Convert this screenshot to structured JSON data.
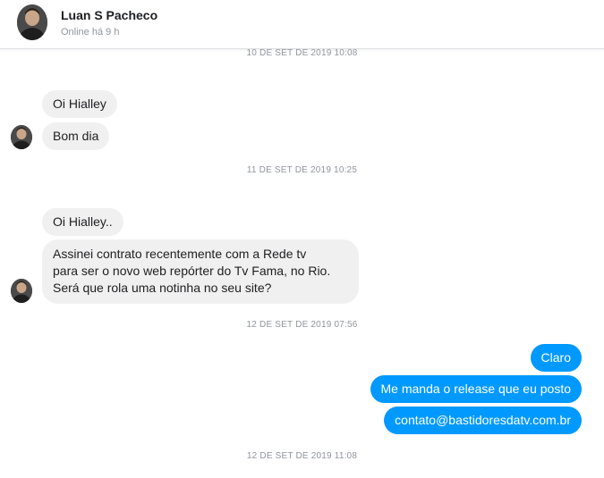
{
  "header": {
    "contact_name": "Luan S Pacheco",
    "contact_status": "Online há 9 h"
  },
  "conversation": {
    "timestamps": [
      "10 DE SET DE 2019 10:08",
      "11 DE SET DE 2019 10:25",
      "12 DE SET DE 2019 07:56",
      "12 DE SET DE 2019 11:08"
    ],
    "group1": [
      "Oi Hialley",
      "Bom dia"
    ],
    "group2": {
      "first": "Oi Hialley..",
      "second_lines": [
        "Assinei contrato recentemente com a Rede tv",
        "para ser o novo web repórter do Tv Fama, no Rio.",
        "Será que rola uma notinha no seu site?"
      ]
    },
    "outgoing": [
      "Claro",
      "Me manda o release que eu posto",
      "contato@bastidoresdatv.com.br"
    ]
  },
  "colors": {
    "incoming_bubble": "#f1f0f0",
    "outgoing_bubble": "#0099ff",
    "timestamp_text": "#90949c"
  },
  "icons": {
    "contact_avatar": "contact-avatar-photo"
  }
}
